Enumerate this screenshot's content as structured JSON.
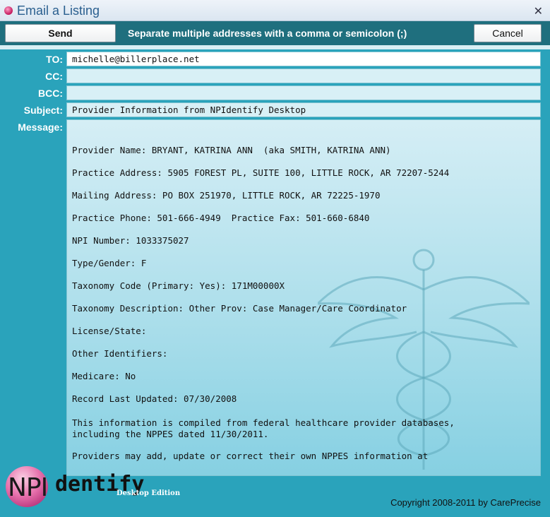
{
  "window": {
    "title": "Email a Listing"
  },
  "toolbar": {
    "send_label": "Send",
    "hint": "Separate multiple addresses with a comma or semicolon (;)",
    "cancel_label": "Cancel"
  },
  "fields": {
    "to_label": "TO:",
    "to_value": "michelle@billerplace.net",
    "cc_label": "CC:",
    "cc_value": "",
    "bcc_label": "BCC:",
    "bcc_value": "",
    "subject_label": "Subject:",
    "subject_value": "Provider Information from NPIdentify Desktop",
    "message_label": "Message:"
  },
  "message": {
    "lines": [
      "Provider Name: BRYANT, KATRINA ANN  (aka SMITH, KATRINA ANN)",
      "Practice Address: 5905 FOREST PL, SUITE 100, LITTLE ROCK, AR 72207-5244",
      "Mailing Address: PO BOX 251970, LITTLE ROCK, AR 72225-1970",
      "Practice Phone: 501-666-4949  Practice Fax: 501-660-6840",
      "NPI Number: 1033375027",
      "Type/Gender: F",
      "Taxonomy Code (Primary: Yes): 171M00000X",
      "Taxonomy Description: Other Prov: Case Manager/Care Coordinator",
      "License/State:",
      "Other Identifiers:",
      "Medicare: No",
      "Record Last Updated: 07/30/2008"
    ],
    "para1": "This information is compiled from federal healthcare provider databases,\nincluding the NPPES dated 11/30/2011.",
    "para2": "Providers may add, update or correct their own NPPES information at"
  },
  "footer": {
    "logo_npi": "NPI",
    "logo_dentify": "dentify",
    "logo_edition": "Desktop Edition",
    "copyright": "Copyright 2008-2011 by CarePrecise"
  },
  "colors": {
    "background": "#2aa3bb",
    "toolbar": "#1f6f7e",
    "title_text": "#2a5f8f"
  },
  "icons": {
    "app": "app-icon",
    "close": "close-icon",
    "watermark": "caduceus-icon"
  }
}
